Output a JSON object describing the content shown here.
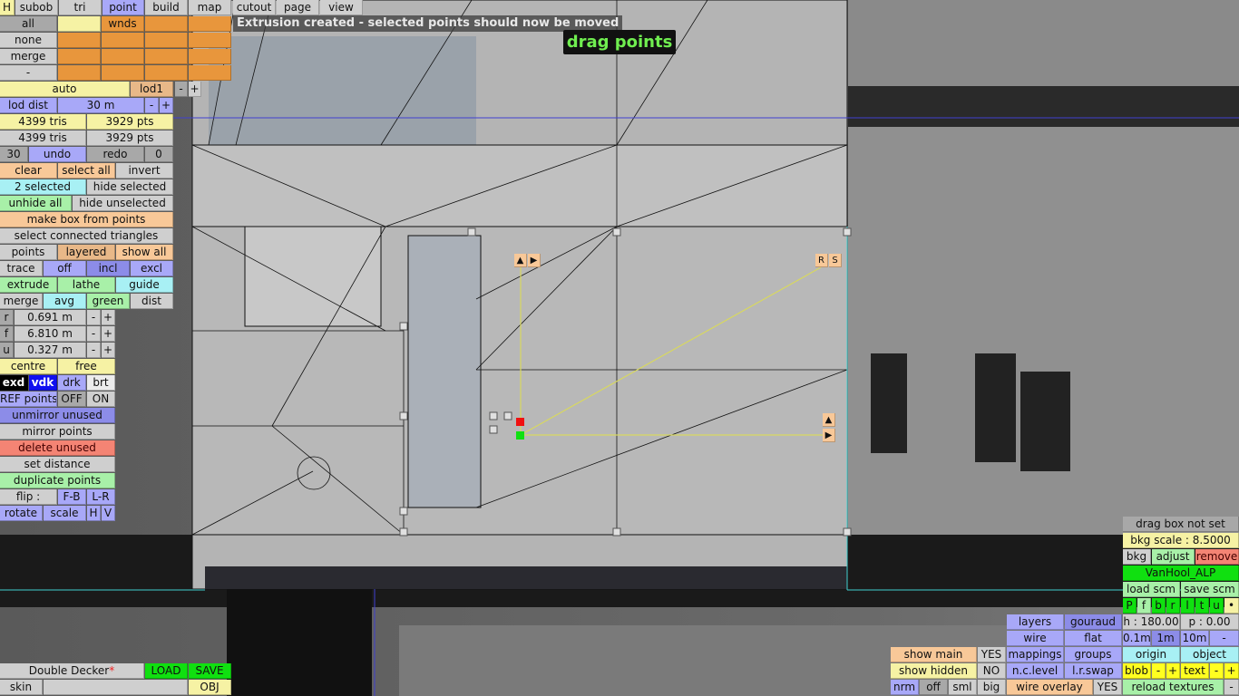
{
  "status_message": "Extrusion created - selected points should now be moved",
  "mode_label": "drag points",
  "menu": {
    "H": "H",
    "subob": "subob",
    "tri": "tri",
    "point": "point",
    "build": "build",
    "map": "map",
    "cutout": "cutout",
    "page": "page",
    "view": "view"
  },
  "select": {
    "all": "all",
    "wnds": "wnds",
    "none": "none",
    "merge": "merge",
    "dash": "-"
  },
  "lod": {
    "auto": "auto",
    "lod1": "lod1",
    "minus": "-",
    "plus": "+",
    "lod_dist": "lod dist",
    "dist_value": "30 m"
  },
  "stats": {
    "tris1": "4399 tris",
    "pts1": "3929 pts",
    "tris2": "4399 tris",
    "pts2": "3929 pts"
  },
  "history": {
    "undo_count": "30",
    "undo": "undo",
    "redo": "redo",
    "redo_count": "0"
  },
  "selection": {
    "clear": "clear",
    "select_all": "select all",
    "invert": "invert",
    "selected": "2 selected",
    "hide_selected": "hide selected",
    "unhide_all": "unhide all",
    "hide_unselected": "hide unselected",
    "make_box": "make box from points",
    "select_connected": "select connected triangles"
  },
  "display": {
    "points": "points",
    "layered": "layered",
    "show_all": "show all"
  },
  "trace": {
    "trace": "trace",
    "off": "off",
    "incl": "incl",
    "excl": "excl"
  },
  "ops": {
    "extrude": "extrude",
    "lathe": "lathe",
    "guide": "guide",
    "merge": "merge",
    "avg": "avg",
    "green": "green",
    "dist": "dist"
  },
  "coords": [
    {
      "axis": "r",
      "value": "0.691 m"
    },
    {
      "axis": "f",
      "value": "6.810 m"
    },
    {
      "axis": "u",
      "value": "0.327 m"
    }
  ],
  "pivot": {
    "centre": "centre",
    "free": "free"
  },
  "shade": {
    "exd": "exd",
    "vdk": "vdk",
    "drk": "drk",
    "brt": "brt"
  },
  "ref": {
    "label": "REF points",
    "off": "OFF",
    "on": "ON"
  },
  "actions": {
    "unmirror": "unmirror unused",
    "mirror": "mirror points",
    "delete_unused": "delete unused",
    "set_distance": "set distance",
    "duplicate": "duplicate points"
  },
  "flip": {
    "label": "flip :",
    "fb": "F-B",
    "lr": "L-R"
  },
  "transform": {
    "rotate": "rotate",
    "scale": "scale",
    "h": "H",
    "v": "V"
  },
  "file": {
    "name": "Double Decker",
    "modified_mark": "*",
    "load": "LOAD",
    "save": "SAVE",
    "skin": "skin",
    "obj": "OBJ"
  },
  "background": {
    "drag_box": "drag box not set",
    "bkg_scale": "bkg scale : 8.5000",
    "bkg": "bkg",
    "adjust": "adjust",
    "remove": "remove",
    "name": "VanHool_ALP",
    "load_scm": "load scm",
    "save_scm": "save scm",
    "views": [
      "P",
      "f",
      "b",
      "r",
      "l",
      "t",
      "u",
      "•"
    ],
    "h": "h : 180.00",
    "p": "p : 0.00"
  },
  "render": {
    "layers": "layers",
    "gouraud": "gouraud",
    "wire": "wire",
    "flat": "flat",
    "mappings": "mappings",
    "groups": "groups",
    "nclevel": "n.c.level",
    "lrswap": "l.r.swap",
    "wire_overlay": "wire overlay",
    "wire_overlay_val": "YES"
  },
  "grid": {
    "s01": "0.1m",
    "s1": "1m",
    "s10": "10m",
    "minus": "-"
  },
  "snap": {
    "origin": "origin",
    "object": "object",
    "blob": "blob",
    "text": "text",
    "minus": "-",
    "plus": "+",
    "reload": "reload textures",
    "reload_minus": "-"
  },
  "show": {
    "main": "show main",
    "main_val": "YES",
    "hidden": "show hidden",
    "hidden_val": "NO",
    "nrm": "nrm",
    "off": "off",
    "sml": "sml",
    "big": "big"
  },
  "handles": {
    "up": "▲",
    "right": "▶",
    "r": "R",
    "s": "S"
  }
}
